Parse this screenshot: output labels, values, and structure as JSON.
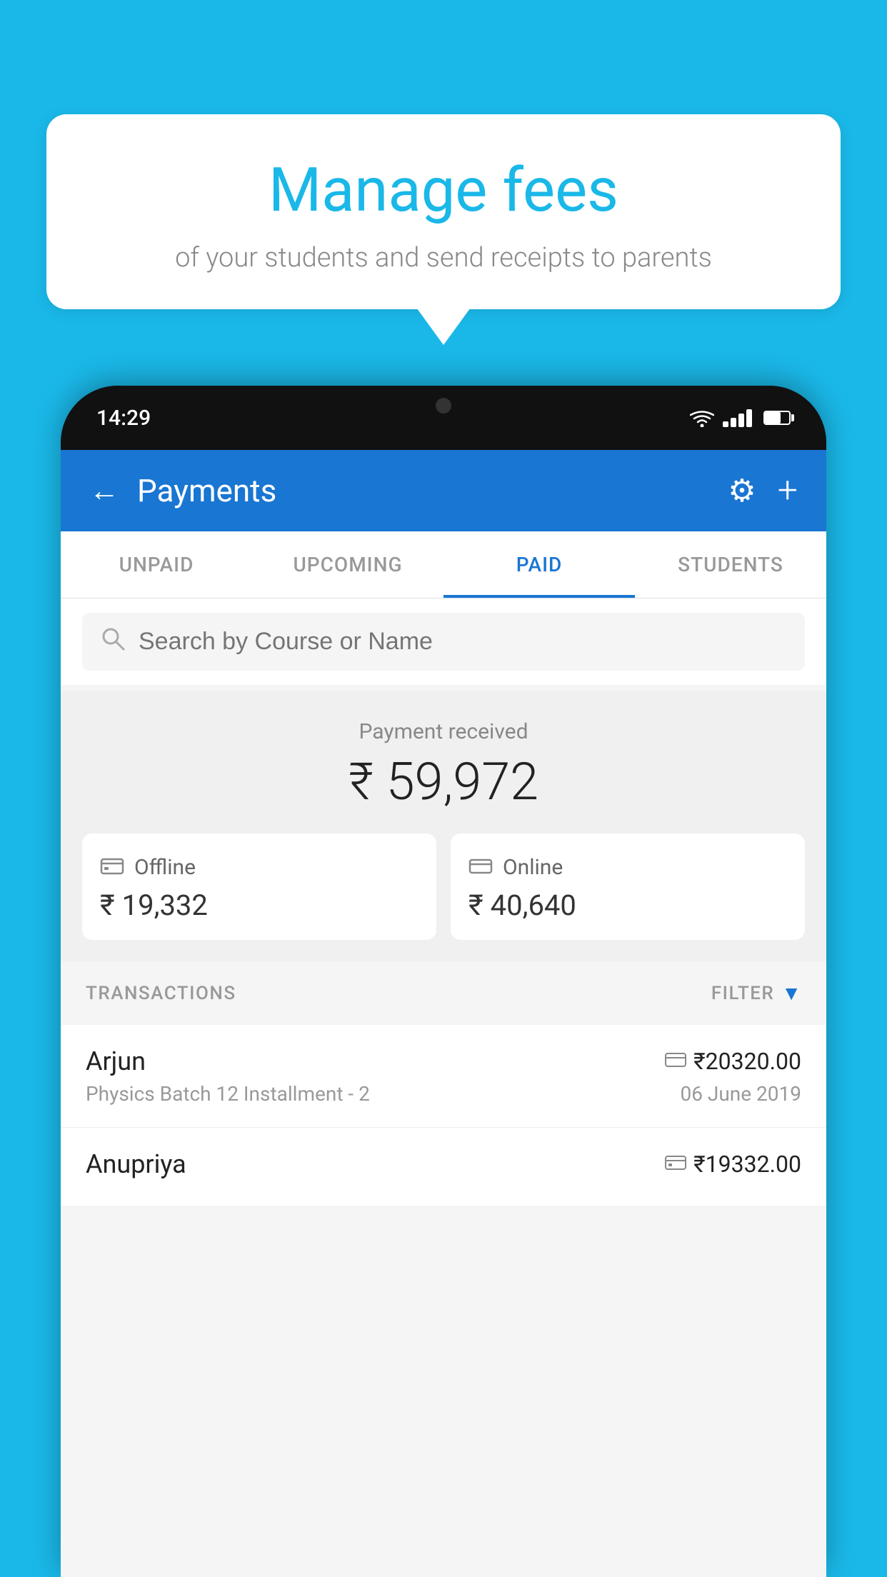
{
  "background_color": "#1ab8e8",
  "speech_bubble": {
    "title": "Manage fees",
    "subtitle": "of your students and send receipts to parents"
  },
  "phone": {
    "status_bar": {
      "time": "14:29",
      "icons": [
        "wifi",
        "signal",
        "battery"
      ]
    },
    "app": {
      "header": {
        "title": "Payments",
        "back_label": "←",
        "gear_label": "⚙",
        "plus_label": "+"
      },
      "tabs": [
        {
          "label": "UNPAID",
          "active": false
        },
        {
          "label": "UPCOMING",
          "active": false
        },
        {
          "label": "PAID",
          "active": true
        },
        {
          "label": "STUDENTS",
          "active": false
        }
      ],
      "search": {
        "placeholder": "Search by Course or Name"
      },
      "payment_summary": {
        "received_label": "Payment received",
        "amount": "₹ 59,972",
        "offline": {
          "type": "Offline",
          "amount": "₹ 19,332"
        },
        "online": {
          "type": "Online",
          "amount": "₹ 40,640"
        }
      },
      "transactions": {
        "header_label": "TRANSACTIONS",
        "filter_label": "FILTER",
        "rows": [
          {
            "name": "Arjun",
            "amount": "₹20320.00",
            "course": "Physics Batch 12 Installment - 2",
            "date": "06 June 2019",
            "payment_type": "card"
          },
          {
            "name": "Anupriya",
            "amount": "₹19332.00",
            "course": "",
            "date": "",
            "payment_type": "offline"
          }
        ]
      }
    }
  }
}
